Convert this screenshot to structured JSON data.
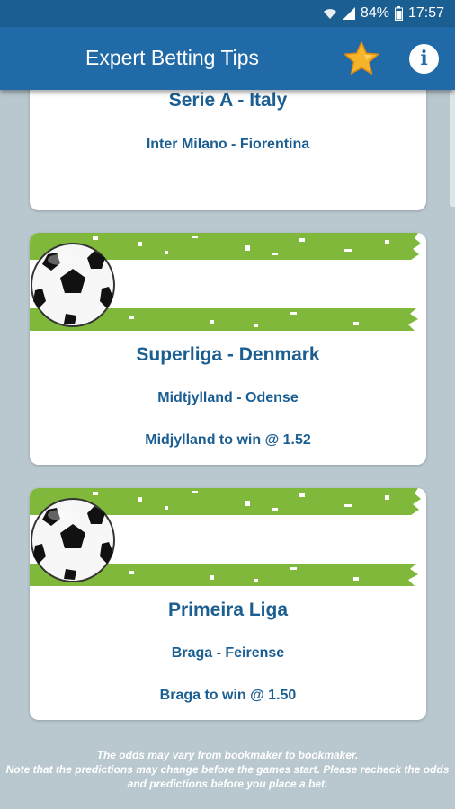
{
  "status_bar": {
    "battery": "84%",
    "time": "17:57"
  },
  "app_bar": {
    "title": "Expert Betting Tips",
    "favorite_icon": "star-icon",
    "info_label": "i"
  },
  "tips": [
    {
      "league": "Serie A - Italy",
      "match": "Inter Milano - Fiorentina",
      "tip": ""
    },
    {
      "league": "Superliga - Denmark",
      "match": "Midtjylland - Odense",
      "tip": "Midjylland to win @ 1.52"
    },
    {
      "league": "Primeira Liga",
      "match": "Braga - Feirense",
      "tip": "Braga to win @ 1.50"
    }
  ],
  "footer": {
    "line1": "The odds may vary from bookmaker to bookmaker.",
    "line2": "Note that the predictions may change before the games start. Please recheck the odds and predictions before you place a bet."
  },
  "colors": {
    "app_bar": "#1f6aa7",
    "status_bar": "#1b5e92",
    "background": "#b9c7cf",
    "text_accent": "#1b5e92",
    "banner_green": "#7fb83a",
    "star": "#f5b52a"
  }
}
